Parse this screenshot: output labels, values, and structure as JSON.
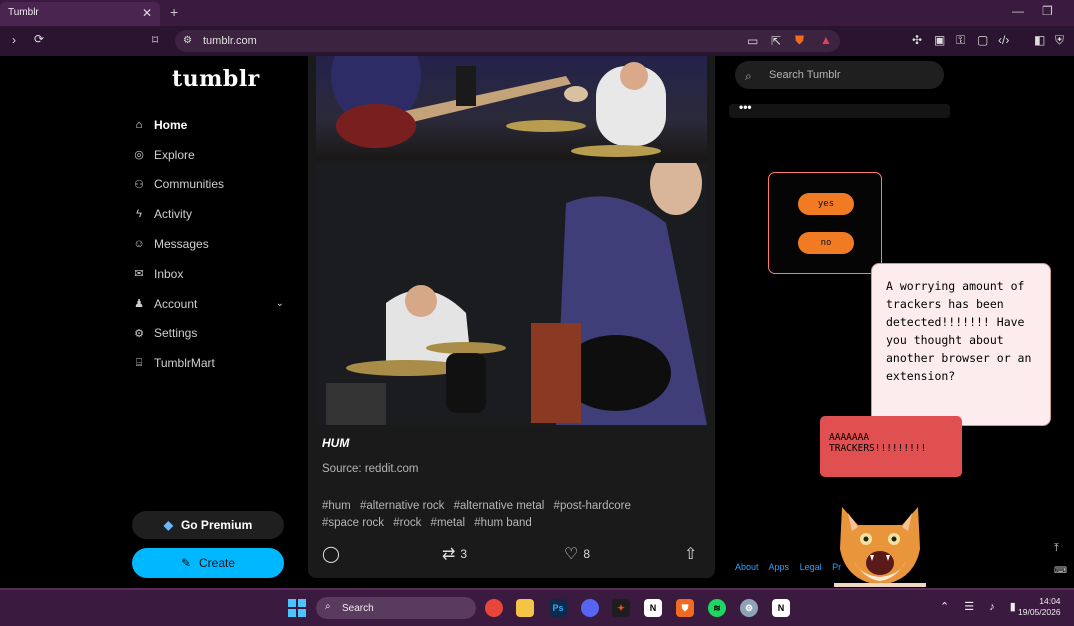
{
  "browser": {
    "tab_title": "Tumblr",
    "url": "tumblr.com"
  },
  "sidebar": {
    "logo": "tumblr",
    "items": [
      {
        "label": "Home",
        "icon": "home-icon"
      },
      {
        "label": "Explore",
        "icon": "compass-icon"
      },
      {
        "label": "Communities",
        "icon": "people-icon"
      },
      {
        "label": "Activity",
        "icon": "bolt-icon"
      },
      {
        "label": "Messages",
        "icon": "chat-icon"
      },
      {
        "label": "Inbox",
        "icon": "envelope-icon"
      },
      {
        "label": "Account",
        "icon": "person-icon"
      },
      {
        "label": "Settings",
        "icon": "gear-icon"
      },
      {
        "label": "TumblrMart",
        "icon": "shop-icon"
      }
    ],
    "premium_label": "Go Premium",
    "create_label": "Create"
  },
  "post": {
    "title": "HUM",
    "source": "Source: reddit.com",
    "tags": [
      "#hum",
      "#alternative rock",
      "#alternative metal",
      "#post-hardcore",
      "#space rock",
      "#rock",
      "#metal",
      "#hum band"
    ],
    "reblogs": "3",
    "likes": "8"
  },
  "right": {
    "search_placeholder": "Search Tumblr",
    "more": "•••",
    "popup": {
      "yes": "yes",
      "no": "no"
    },
    "bubble_text": "A worrying amount of trackers has been detected!!!!!!! Have you thought about another browser or an extension?",
    "alarm_line1": "AAAAAAA",
    "alarm_line2": "TRACKERS!!!!!!!!!",
    "footer": [
      "About",
      "Apps",
      "Legal",
      "Pr"
    ]
  },
  "taskbar": {
    "search": "Search",
    "time": "14:04",
    "date": "19/05/2026"
  },
  "colors": {
    "accent_blue": "#00b8ff",
    "popup_orange": "#f07b22",
    "alarm_red": "#e05050",
    "browser_purple": "#3b1a3f"
  }
}
